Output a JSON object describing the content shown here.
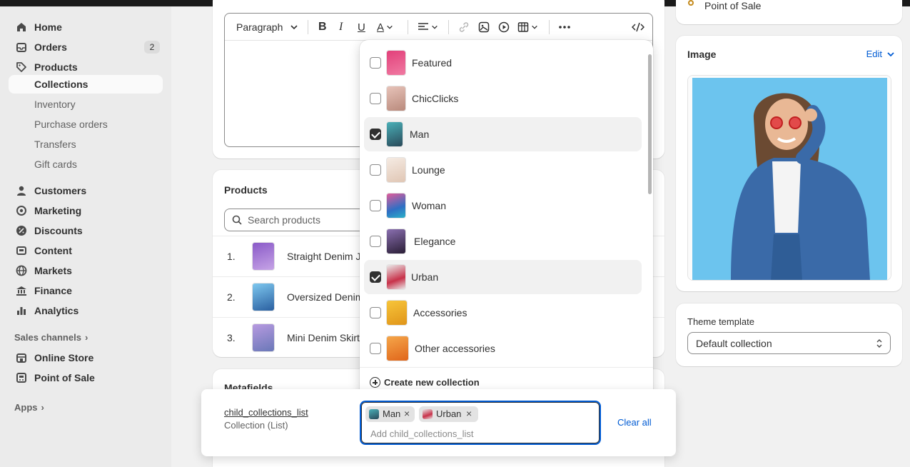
{
  "sidebar": {
    "items": [
      {
        "label": "Home",
        "icon": "home-icon"
      },
      {
        "label": "Orders",
        "icon": "orders-icon",
        "badge": "2"
      },
      {
        "label": "Products",
        "icon": "tag-icon"
      },
      {
        "label": "Collections"
      },
      {
        "label": "Inventory"
      },
      {
        "label": "Purchase orders"
      },
      {
        "label": "Transfers"
      },
      {
        "label": "Gift cards"
      },
      {
        "label": "Customers",
        "icon": "person-icon"
      },
      {
        "label": "Marketing",
        "icon": "target-icon"
      },
      {
        "label": "Discounts",
        "icon": "discount-icon"
      },
      {
        "label": "Content",
        "icon": "content-icon"
      },
      {
        "label": "Markets",
        "icon": "globe-icon"
      },
      {
        "label": "Finance",
        "icon": "bank-icon"
      },
      {
        "label": "Analytics",
        "icon": "chart-icon"
      }
    ],
    "sales_channels_label": "Sales channels",
    "channels": [
      {
        "label": "Online Store",
        "icon": "store-icon"
      },
      {
        "label": "Point of Sale",
        "icon": "pos-icon"
      }
    ],
    "apps_label": "Apps"
  },
  "editor": {
    "paragraph_label": "Paragraph"
  },
  "products_card": {
    "title": "Products",
    "search_placeholder": "Search products",
    "rows": [
      {
        "num": "1.",
        "name": "Straight Denim J"
      },
      {
        "num": "2.",
        "name": "Oversized Denim"
      },
      {
        "num": "3.",
        "name": "Mini Denim Skirt"
      }
    ]
  },
  "metafields_card": {
    "title": "Metafields"
  },
  "dropdown": {
    "options": [
      {
        "label": "Featured",
        "checked": false,
        "color": "#e2407a"
      },
      {
        "label": "ChicClicks",
        "checked": false,
        "color": "#d9a79a"
      },
      {
        "label": "Man",
        "checked": true,
        "color": "#4a9fa8"
      },
      {
        "label": "Lounge",
        "checked": false,
        "color": "#e8d6c8"
      },
      {
        "label": "Woman",
        "checked": false,
        "color": "#2f6fc4"
      },
      {
        "label": "Elegance",
        "checked": false,
        "color": "#6b4e8c"
      },
      {
        "label": "Urban",
        "checked": true,
        "color": "#c9c9c9"
      },
      {
        "label": "Accessories",
        "checked": false,
        "color": "#f2b21c"
      },
      {
        "label": "Other accessories",
        "checked": false,
        "color": "#f08a24"
      }
    ],
    "create_label": "Create new collection"
  },
  "metafield": {
    "name": "child_collections_list",
    "type": "Collection (List)",
    "tags": [
      {
        "label": "Man",
        "remove": "×"
      },
      {
        "label": "Urban",
        "remove": "×"
      }
    ],
    "placeholder": "Add child_collections_list",
    "clear_label": "Clear all"
  },
  "right": {
    "pos_text": "Point of Sale",
    "image_title": "Image",
    "edit_label": "Edit",
    "template_label": "Theme template",
    "template_value": "Default collection"
  },
  "colors": {
    "accent": "#005bd3",
    "image_bg": "#6cc4ee"
  }
}
